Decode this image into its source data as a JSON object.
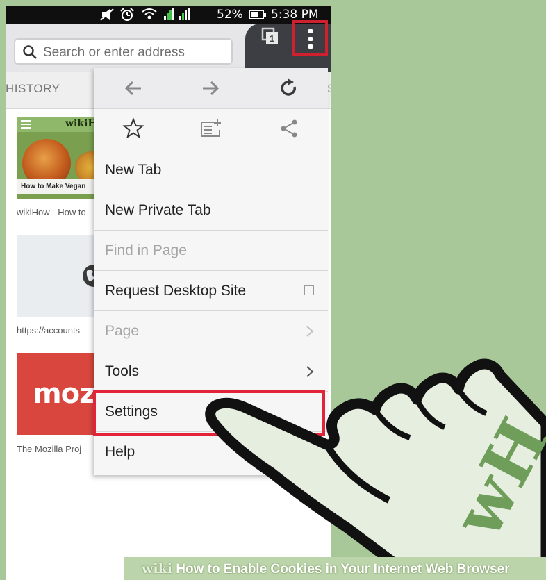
{
  "status_bar": {
    "battery": "52%",
    "time": "5:38 PM"
  },
  "toolbar": {
    "url_placeholder": "Search or enter address",
    "tabs_count": "1"
  },
  "top_tabs": {
    "history_label": "HISTORY",
    "next_tab_partial": "S"
  },
  "thumbnails": [
    {
      "banner": "How to Make Vegan",
      "caption": "wikiHow - How to",
      "brand": "wikiH"
    },
    {
      "caption": "https://accounts"
    },
    {
      "caption": "The Mozilla Proj",
      "brand_text": "moz"
    }
  ],
  "menu": {
    "items": [
      {
        "label": "New Tab"
      },
      {
        "label": "New Private Tab"
      },
      {
        "label": "Find in Page"
      },
      {
        "label": "Request Desktop Site"
      },
      {
        "label": "Page"
      },
      {
        "label": "Tools"
      },
      {
        "label": "Settings"
      },
      {
        "label": "Help"
      }
    ]
  },
  "watermark": {
    "wiki": "wiki",
    "title": "How to Enable Cookies in Your Internet Web Browser"
  },
  "logo": {
    "text": "wH"
  },
  "colors": {
    "highlight": "#e2233a",
    "background": "#a9c89a",
    "mozilla_red": "#d8463e"
  }
}
